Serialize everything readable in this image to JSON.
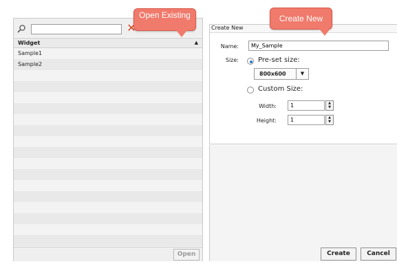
{
  "search": {
    "value": "",
    "placeholder": ""
  },
  "list": {
    "header": "Widget",
    "rows": [
      "Sample1",
      "Sample2"
    ],
    "open_label": "Open"
  },
  "form": {
    "title": "Create New",
    "name_label": "Name:",
    "name_value": "My_Sample",
    "size_label": "Size:",
    "preset_label": "Pre-set size:",
    "preset_value": "800x600",
    "custom_label": "Custom Size:",
    "width_label": "Width:",
    "width_value": "1",
    "height_label": "Height:",
    "height_value": "1",
    "selected_size_mode": "preset"
  },
  "buttons": {
    "create": "Create",
    "cancel": "Cancel"
  },
  "callouts": {
    "open_existing": "Open Existing",
    "create_new": "Create New"
  },
  "icons": {
    "search": "search-icon",
    "clear": "clear-icon",
    "sort": "sort-asc-icon",
    "spin": "spin-icon"
  },
  "colors": {
    "callout": "#f07a6c",
    "clear": "#d4421d",
    "radio_selected": "#2a72c8"
  }
}
